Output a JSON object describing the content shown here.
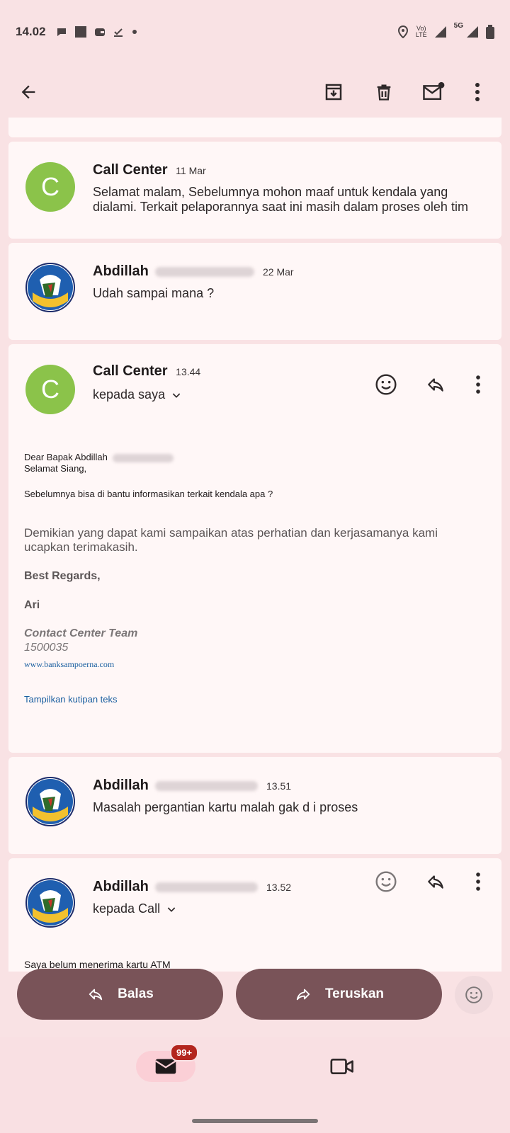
{
  "status_bar": {
    "time": "14.02",
    "volte_top": "Vo)",
    "volte_bottom": "LTE",
    "network": "5G"
  },
  "colors": {
    "background": "#f9e2e4",
    "card": "#fff7f7",
    "primary_button": "#795358",
    "avatar_green": "#8bc34a",
    "link": "#1a5fa0",
    "badge": "#b3261e"
  },
  "messages": [
    {
      "sender": "Call Center",
      "date": "11 Mar",
      "avatar_letter": "C",
      "snippet": "Selamat malam, Sebelumnya mohon maaf untuk kendala yang dialami. Terkait pelaporannya saat ini masih dalam proses oleh tim"
    },
    {
      "sender": "Abdillah",
      "date": "22 Mar",
      "snippet": "Udah sampai mana ?"
    },
    {
      "sender": "Call Center",
      "date": "13.44",
      "avatar_letter": "C",
      "recipient": "kepada saya",
      "body": {
        "greeting": "Dear Bapak Abdillah",
        "greeting2": "Selamat Siang,",
        "question": "Sebelumnya bisa di bantu informasikan terkait kendala apa ?",
        "closing": "Demikian yang dapat kami sampaikan atas perhatian dan kerjasamanya kami ucapkan terimakasih.",
        "regards": "Best Regards,",
        "name": "Ari",
        "team": "Contact Center Team",
        "phone": "1500035",
        "website": "www.banksampoerna.com",
        "show_quoted": "Tampilkan kutipan teks"
      }
    },
    {
      "sender": "Abdillah",
      "date": "13.51",
      "snippet": "Masalah pergantian kartu malah gak d i proses"
    },
    {
      "sender": "Abdillah",
      "date": "13.52",
      "recipient": "kepada Call",
      "body_preview": "Saya belum menerima kartu ATM"
    }
  ],
  "bottom_actions": {
    "reply": "Balas",
    "forward": "Teruskan"
  },
  "nav": {
    "mail_badge": "99+"
  }
}
